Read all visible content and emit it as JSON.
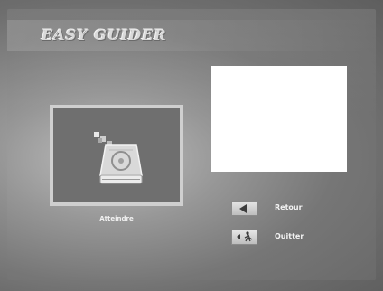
{
  "app": {
    "title": "Easy Guider"
  },
  "main_item": {
    "label": "Atteindre",
    "icon": "storage-drive-icon"
  },
  "menu": [
    {
      "label": "Retour",
      "icon": "back-arrow-icon"
    },
    {
      "label": "Quitter",
      "icon": "exit-icon"
    }
  ]
}
